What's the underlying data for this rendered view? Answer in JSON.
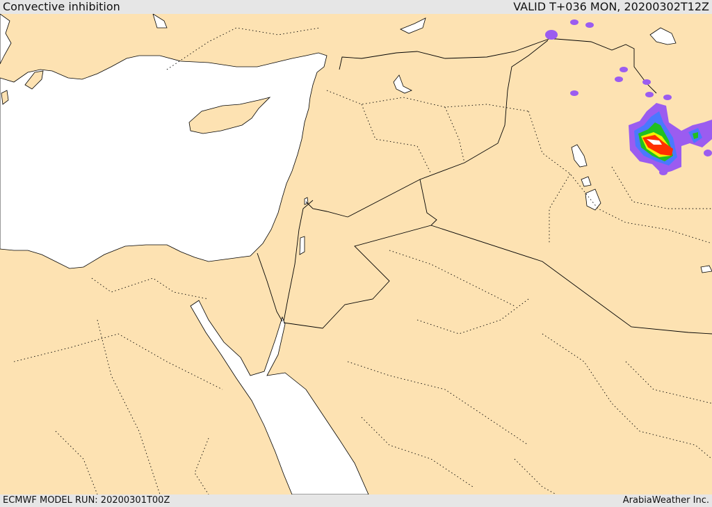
{
  "header": {
    "title": "Convective inhibition",
    "valid": "VALID T+036 MON, 20200302T12Z"
  },
  "footer": {
    "model_run": "ECMWF MODEL RUN: 20200301T00Z",
    "credit": "ArabiaWeather Inc."
  },
  "colors": {
    "land": "#fde2b2",
    "sea": "#ffffff",
    "cin_levels": [
      "#9b5cf0",
      "#4a78ff",
      "#20c020",
      "#f2f200",
      "#ff3000",
      "#e00000"
    ]
  }
}
